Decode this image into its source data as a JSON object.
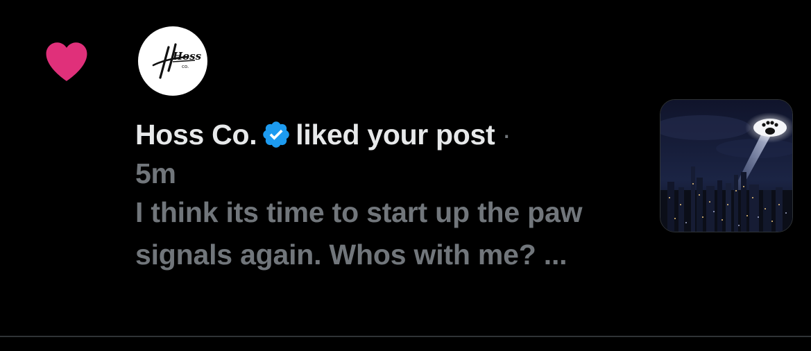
{
  "notification": {
    "type": "like",
    "heart_color": "#e0307a",
    "avatar_logo_text": "Hoss",
    "avatar_logo_subtext": "co.",
    "user_name": "Hoss Co.",
    "verified": true,
    "verified_color": "#1d9bf0",
    "action_text": "liked your post",
    "separator": "·",
    "time": "5m",
    "post_excerpt": "I think its time to start up the paw signals again. Whos with me? ...",
    "thumbnail_icon": "paw-signal-night-city-image"
  }
}
